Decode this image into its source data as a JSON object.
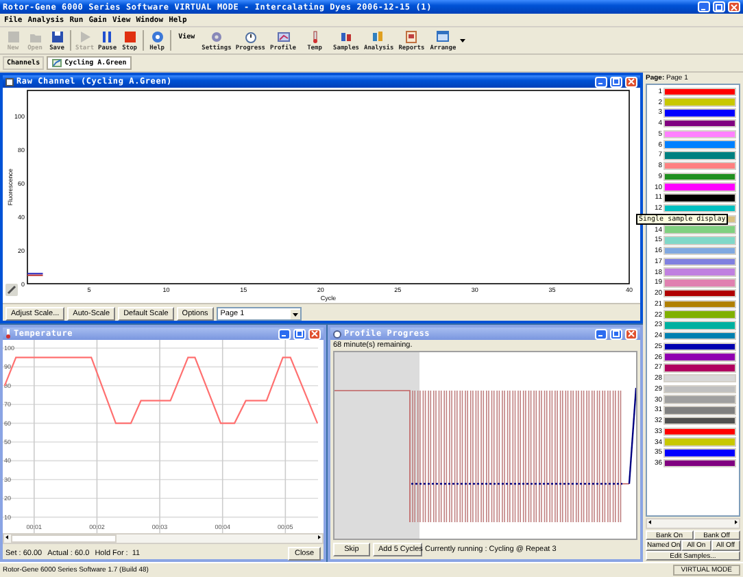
{
  "window": {
    "title": "Rotor-Gene 6000 Series Software VIRTUAL MODE - Intercalating Dyes 2006-12-15 (1)"
  },
  "menu": [
    "File",
    "Analysis",
    "Run",
    "Gain",
    "View",
    "Window",
    "Help"
  ],
  "toolbar": {
    "left": [
      {
        "label": "New",
        "disabled": true
      },
      {
        "label": "Open",
        "disabled": true
      },
      {
        "label": "Save",
        "disabled": false
      },
      {
        "label": "Start",
        "disabled": true
      },
      {
        "label": "Pause",
        "disabled": false
      },
      {
        "label": "Stop",
        "disabled": false
      },
      {
        "label": "Help",
        "disabled": false
      }
    ],
    "view_label": "View",
    "view": [
      {
        "label": "Settings"
      },
      {
        "label": "Progress"
      },
      {
        "label": "Profile"
      },
      {
        "label": "Temp"
      },
      {
        "label": "Samples"
      },
      {
        "label": "Analysis"
      },
      {
        "label": "Reports"
      },
      {
        "label": "Arrange"
      }
    ]
  },
  "channels": {
    "label": "Channels",
    "tabs": [
      {
        "label": "Cycling A.Green",
        "selected": true
      }
    ]
  },
  "raw_window": {
    "title": "Raw Channel (Cycling A.Green)",
    "active": true,
    "chart_data": {
      "type": "line",
      "xlabel": "Cycle",
      "ylabel": "Fluorescence",
      "x": [
        1,
        2
      ],
      "series": [
        {
          "color": "#3030c0",
          "values": [
            6,
            6
          ]
        },
        {
          "color": "#c04040",
          "values": [
            5,
            5
          ]
        }
      ],
      "xlim": [
        1,
        40
      ],
      "ylim": [
        0,
        115
      ],
      "xticks": [
        5,
        10,
        15,
        20,
        25,
        30,
        35,
        40
      ],
      "yticks": [
        0,
        20,
        40,
        60,
        80,
        100
      ]
    },
    "buttons": [
      "Adjust Scale...",
      "Auto-Scale",
      "Default Scale",
      "Options"
    ],
    "page_select": {
      "value": "Page 1"
    }
  },
  "temp_window": {
    "title": "Temperature",
    "active": false,
    "chart_data": {
      "type": "line",
      "x": [
        0.53,
        0.71,
        1.91,
        2.3,
        2.54,
        2.7,
        3.17,
        3.45,
        3.56,
        3.97,
        4.19,
        4.37,
        4.7,
        4.96,
        5.08,
        5.51
      ],
      "series": [
        {
          "color": "#ff7070",
          "values": [
            80,
            95,
            95,
            60,
            60,
            72,
            72,
            95,
            95,
            60,
            60,
            72,
            72,
            95,
            95,
            60
          ]
        }
      ],
      "xlim": [
        0.5,
        5.52
      ],
      "ylim": [
        0,
        100
      ],
      "grid": true,
      "xticks": [
        {
          "value": 1,
          "label": "00:01"
        },
        {
          "value": 2,
          "label": "00:02"
        },
        {
          "value": 3,
          "label": "00:03"
        },
        {
          "value": 4,
          "label": "00:04"
        },
        {
          "value": 5,
          "label": "00:05"
        }
      ],
      "yticks": [
        10,
        20,
        30,
        40,
        50,
        60,
        70,
        80,
        90,
        100
      ]
    },
    "readouts": [
      "Set : 60.00",
      "Actual : 60.0",
      "Hold For :  11"
    ],
    "close_button": "Close"
  },
  "profile_window": {
    "title": "Profile Progress",
    "active": false,
    "remaining": "68 minute(s) remaining.",
    "buttons": [
      "Skip",
      "Add 5 Cycles"
    ],
    "status": "Currently running : Cycling @ Repeat 3"
  },
  "samples": {
    "page_label": "**Page:** Page 1",
    "rows": [
      {
        "number": "1",
        "color": "#ff0000"
      },
      {
        "number": "2",
        "color": "#c8c800"
      },
      {
        "number": "3",
        "color": "#0000ff"
      },
      {
        "number": "4",
        "color": "#800080"
      },
      {
        "number": "5",
        "color": "#ff80ff"
      },
      {
        "number": "6",
        "color": "#0080ff"
      },
      {
        "number": "7",
        "color": "#008080"
      },
      {
        "number": "8",
        "color": "#ff8080"
      },
      {
        "number": "9",
        "color": "#209020"
      },
      {
        "number": "10",
        "color": "#ff00ff"
      },
      {
        "number": "11",
        "color": "#000000"
      },
      {
        "number": "12",
        "color": "#00c0c0"
      },
      {
        "color": "#d8c080"
      },
      {
        "number": "14",
        "color": "#80d080"
      },
      {
        "number": "15",
        "color": "#80d8c8"
      },
      {
        "number": "16",
        "color": "#80a8e0"
      },
      {
        "number": "17",
        "color": "#8080e0"
      },
      {
        "number": "18",
        "color": "#c080e0"
      },
      {
        "number": "19",
        "color": "#e080b0"
      },
      {
        "number": "20",
        "color": "#b00000"
      },
      {
        "number": "21",
        "color": "#b08000"
      },
      {
        "number": "22",
        "color": "#80b000"
      },
      {
        "number": "23",
        "color": "#00b0a0"
      },
      {
        "number": "24",
        "color": "#0080b0"
      },
      {
        "number": "25",
        "color": "#0000b0"
      },
      {
        "number": "26",
        "color": "#9000b0"
      },
      {
        "number": "27",
        "color": "#b00060"
      },
      {
        "number": "28",
        "color": "#d8d8d8"
      },
      {
        "number": "29",
        "color": "#c0c0c0"
      },
      {
        "number": "30",
        "color": "#a0a0a0"
      },
      {
        "number": "31",
        "color": "#808080"
      },
      {
        "number": "32",
        "color": "#505050"
      },
      {
        "number": "33",
        "color": "#ff0000"
      },
      {
        "number": "34",
        "color": "#c8c800"
      },
      {
        "number": "35",
        "color": "#0000ff"
      },
      {
        "number": "36",
        "color": "#800080"
      }
    ],
    "tooltip": "Single sample display",
    "buttons_row1": [
      "Bank On",
      "Bank Off"
    ],
    "buttons_row2": [
      "Named On",
      "All On",
      "All Off"
    ],
    "edit_button": "Edit Samples..."
  },
  "status_bar": {
    "left": "Rotor-Gene 6000 Series Software 1.7 (Build 48)",
    "right": "VIRTUAL MODE"
  }
}
